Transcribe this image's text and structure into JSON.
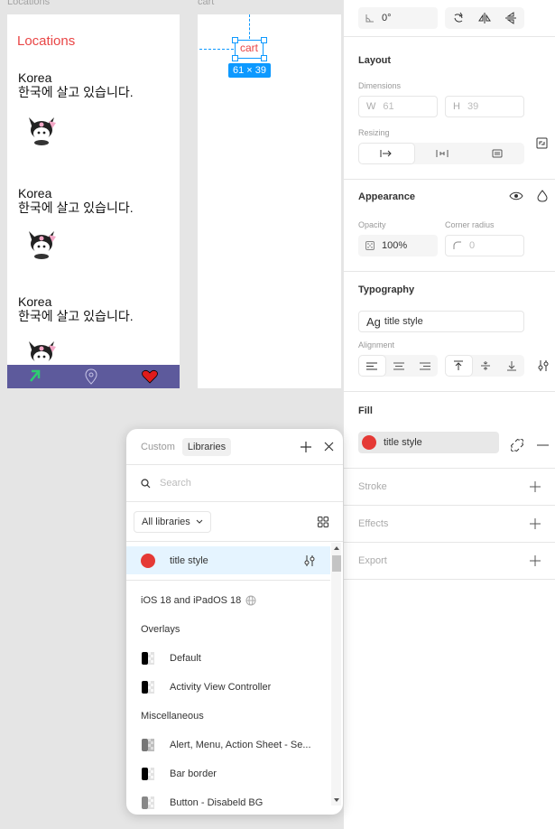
{
  "canvas": {
    "locations_frame_label": "Locations",
    "cart_frame_label": "cart",
    "locations_title": "Locations",
    "entries": [
      {
        "country": "Korea",
        "text": "한국에 살고 있습니다."
      },
      {
        "country": "Korea",
        "text": "한국에 살고 있습니다."
      },
      {
        "country": "Korea",
        "text": "한국에 살고 있습니다."
      }
    ],
    "cart_text": "cart",
    "cart_dimensions": "61 × 39",
    "tabbar_color": "#5d5a9c",
    "title_color": "#e94545",
    "selection_color": "#0d99ff",
    "icons": [
      "arrow-icon",
      "map-pin-icon",
      "heart-icon"
    ]
  },
  "panel": {
    "rotation": "0°",
    "layout": {
      "title": "Layout",
      "dimensions_label": "Dimensions",
      "w_prefix": "W",
      "w_value": "61",
      "h_prefix": "H",
      "h_value": "39",
      "resizing_label": "Resizing"
    },
    "appearance": {
      "title": "Appearance",
      "opacity_label": "Opacity",
      "opacity_value": "100%",
      "radius_label": "Corner radius",
      "radius_value": "0"
    },
    "typography": {
      "title": "Typography",
      "style_prefix": "Ag",
      "style_name": "title style",
      "alignment_label": "Alignment"
    },
    "fill": {
      "title": "Fill",
      "style_name": "title style",
      "color": "#e53935"
    },
    "stroke": {
      "title": "Stroke"
    },
    "effects": {
      "title": "Effects"
    },
    "export": {
      "title": "Export"
    }
  },
  "picker": {
    "tabs": [
      "Custom",
      "Libraries"
    ],
    "search_placeholder": "Search",
    "library_filter": "All libraries",
    "selected_style": "title style",
    "selected_color": "#e53935",
    "library_name": "iOS 18 and iPadOS 18",
    "groups": [
      {
        "name": "Overlays",
        "items": [
          "Default",
          "Activity View Controller"
        ]
      },
      {
        "name": "Miscellaneous",
        "items": [
          "Alert, Menu, Action Sheet - Se...",
          "Bar border",
          "Button - Disabeld BG"
        ]
      }
    ]
  }
}
